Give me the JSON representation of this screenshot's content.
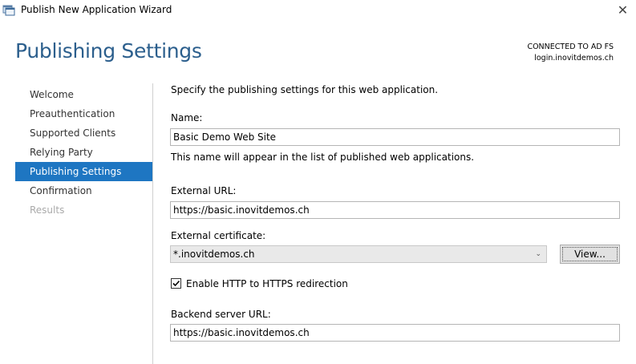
{
  "window": {
    "title": "Publish New Application Wizard",
    "close_glyph": "✕",
    "icon": "wizard-app-icon"
  },
  "header": {
    "page_title": "Publishing Settings",
    "connection_status": "CONNECTED TO AD FS",
    "connection_server": "login.inovitdemos.ch"
  },
  "nav": {
    "items": [
      {
        "label": "Welcome",
        "state": "normal"
      },
      {
        "label": "Preauthentication",
        "state": "normal"
      },
      {
        "label": "Supported Clients",
        "state": "normal"
      },
      {
        "label": "Relying Party",
        "state": "normal"
      },
      {
        "label": "Publishing Settings",
        "state": "active"
      },
      {
        "label": "Confirmation",
        "state": "normal"
      },
      {
        "label": "Results",
        "state": "disabled"
      }
    ],
    "active_color": "#1e76c2"
  },
  "form": {
    "intro": "Specify the publishing settings for this web application.",
    "name_label": "Name:",
    "name_value": "Basic Demo Web Site",
    "name_hint": "This name will appear in the list of published web applications.",
    "external_url_label": "External URL:",
    "external_url_value": "https://basic.inovitdemos.ch",
    "certificate_label": "External certificate:",
    "certificate_value": "*.inovitdemos.ch",
    "view_button": "View...",
    "redirect_label": "Enable HTTP to HTTPS redirection",
    "redirect_checked": true,
    "backend_label": "Backend server URL:",
    "backend_value": "https://basic.inovitdemos.ch"
  },
  "colors": {
    "title_blue": "#2c5f8d",
    "accent": "#1e76c2"
  }
}
